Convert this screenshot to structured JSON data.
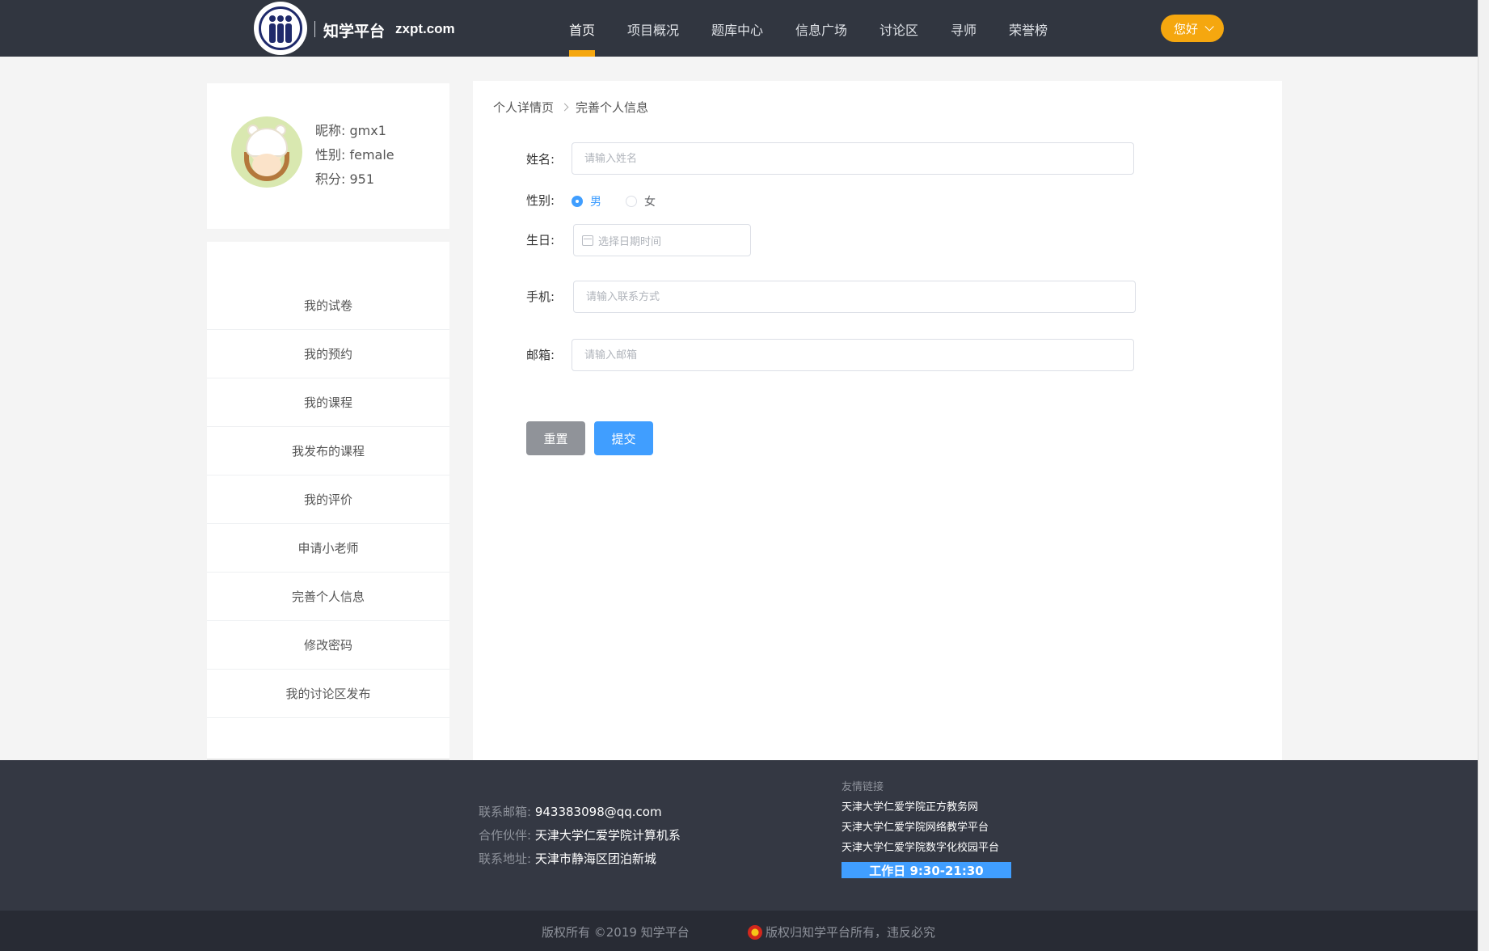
{
  "header": {
    "brand_name": "知学平台",
    "brand_domain": "zxpt.com",
    "nav": [
      "首页",
      "项目概况",
      "题库中心",
      "信息广场",
      "讨论区",
      "寻师",
      "荣誉榜"
    ],
    "active_nav": "首页",
    "greeting": "您好",
    "accent_color": "#f5a70f"
  },
  "profile": {
    "nickname": "昵称: gmx1",
    "gender": "性别: female",
    "points": "积分: 951"
  },
  "sidebar": {
    "items": [
      "我的试卷",
      "我的预约",
      "我的课程",
      "我发布的课程",
      "我的评价",
      "申请小老师",
      "完善个人信息",
      "修改密码",
      "我的讨论区发布"
    ]
  },
  "breadcrumb": {
    "parent": "个人详情页",
    "current": "完善个人信息"
  },
  "form": {
    "name_label": "姓名:",
    "name_placeholder": "请输入姓名",
    "gender_label": "性别:",
    "gender_options": [
      "男",
      "女"
    ],
    "gender_selected": "男",
    "birthday_label": "生日:",
    "birthday_placeholder": "选择日期时间",
    "phone_label": "手机:",
    "phone_placeholder": "请输入联系方式",
    "email_label": "邮箱:",
    "email_placeholder": "请输入邮箱",
    "reset_label": "重置",
    "submit_label": "提交"
  },
  "footer": {
    "email_key": "联系邮箱:",
    "email_value": "943383098@qq.com",
    "partner_key": "合作伙伴:",
    "partner_value": "天津大学仁爱学院计算机系",
    "address_key": "联系地址:",
    "address_value": "天津市静海区团泊新城",
    "links_title": "友情链接",
    "links": [
      "天津大学仁爱学院正方教务网",
      "天津大学仁爱学院网络教学平台",
      "天津大学仁爱学院数字化校园平台"
    ],
    "workday": "工作日 9:30-21:30",
    "copyright": "版权所有 ©2019 知学平台",
    "rights": "版权归知学平台所有，违反必究"
  }
}
